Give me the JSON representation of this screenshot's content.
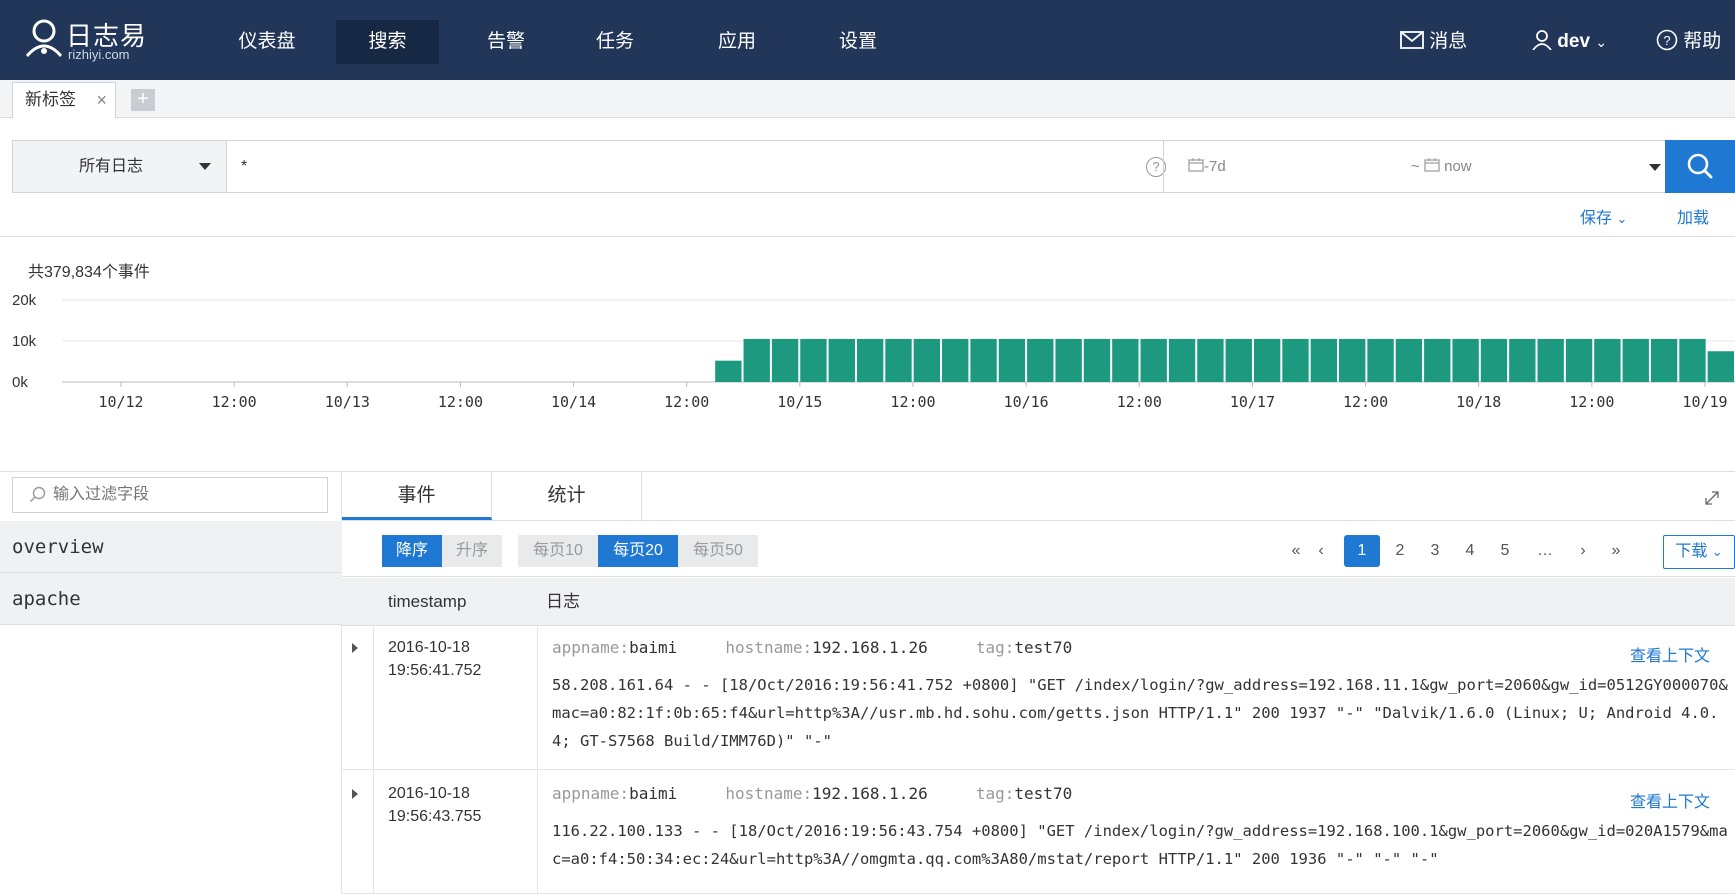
{
  "brand": {
    "name_cn": "日志易",
    "domain": "rizhiyi.com"
  },
  "nav": {
    "items": [
      {
        "label": "仪表盘"
      },
      {
        "label": "搜索"
      },
      {
        "label": "告警"
      },
      {
        "label": "任务"
      },
      {
        "label": "应用"
      },
      {
        "label": "设置"
      }
    ],
    "active": "搜索",
    "messages_label": "消息",
    "user_label": "dev",
    "help_label": "帮助"
  },
  "tabs": {
    "items": [
      {
        "label": "新标签",
        "close": "×"
      }
    ],
    "add_label": "+"
  },
  "search": {
    "source": "所有日志",
    "query": "*",
    "time_from": "-7d",
    "time_sep": "~",
    "time_to": "now",
    "help": "?",
    "save_label": "保存",
    "load_label": "加载"
  },
  "summary": {
    "event_count_text": "共379,834个事件"
  },
  "chart_data": {
    "type": "bar",
    "y_ticks": [
      "20k",
      "10k",
      "0k"
    ],
    "ylim": [
      0,
      20000
    ],
    "x_tick_labels": [
      "10/12",
      "12:00",
      "10/13",
      "12:00",
      "10/14",
      "12:00",
      "10/15",
      "12:00",
      "10/16",
      "12:00",
      "10/17",
      "12:00",
      "10/18",
      "12:00",
      "10/19"
    ],
    "values": [
      0,
      0,
      0,
      0,
      0,
      0,
      0,
      0,
      0,
      0,
      0,
      0,
      0,
      0,
      0,
      0,
      0,
      0,
      0,
      0,
      0,
      0,
      0,
      5200,
      10500,
      10500,
      10500,
      10500,
      10500,
      10500,
      10500,
      10500,
      10500,
      10500,
      10500,
      10500,
      10500,
      10500,
      10500,
      10500,
      10500,
      10500,
      10500,
      10500,
      10500,
      10500,
      10500,
      10500,
      10500,
      10500,
      10500,
      10500,
      10500,
      10500,
      10500,
      10500,
      10500,
      10500,
      7500
    ],
    "color": "#1d9980",
    "grid": true
  },
  "fields": {
    "filter_placeholder": "输入过滤字段",
    "groups": [
      {
        "label": "overview"
      },
      {
        "label": "apache"
      }
    ]
  },
  "results": {
    "tabs": [
      {
        "label": "事件"
      },
      {
        "label": "统计"
      }
    ],
    "sort": {
      "desc": "降序",
      "asc": "升序"
    },
    "page_sizes": [
      {
        "label": "每页10"
      },
      {
        "label": "每页20"
      },
      {
        "label": "每页50"
      }
    ],
    "active_page_size": "每页20",
    "pagination": {
      "first": "«",
      "prev": "‹",
      "pages": [
        "1",
        "2",
        "3",
        "4",
        "5"
      ],
      "current": "1",
      "ellipsis": "…",
      "next": "›",
      "last": "»"
    },
    "download_label": "下载",
    "columns": [
      "timestamp",
      "日志"
    ],
    "context_label": "查看上下文",
    "rows": [
      {
        "date": "2016-10-18",
        "time": "19:56:41.752",
        "appname_key": "appname:",
        "appname": "baimi",
        "hostname_key": "hostname:",
        "hostname": "192.168.1.26",
        "tag_key": "tag:",
        "tag": "test70",
        "log": "58.208.161.64 - - [18/Oct/2016:19:56:41.752 +0800] \"GET /index/login/?gw_address=192.168.11.1&gw_port=2060&gw_id=0512GY000070&mac=a0:82:1f:0b:65:f4&url=http%3A//usr.mb.hd.sohu.com/getts.json HTTP/1.1\" 200 1937 \"-\" \"Dalvik/1.6.0 (Linux; U; Android 4.0.4; GT-S7568 Build/IMM76D)\" \"-\""
      },
      {
        "date": "2016-10-18",
        "time": "19:56:43.755",
        "appname_key": "appname:",
        "appname": "baimi",
        "hostname_key": "hostname:",
        "hostname": "192.168.1.26",
        "tag_key": "tag:",
        "tag": "test70",
        "log": "116.22.100.133 - - [18/Oct/2016:19:56:43.754 +0800] \"GET /index/login/?gw_address=192.168.100.1&gw_port=2060&gw_id=020A1579&mac=a0:f4:50:34:ec:24&url=http%3A//omgmta.qq.com%3A80/mstat/report HTTP/1.1\" 200 1936 \"-\" \"-\" \"-\""
      }
    ]
  },
  "colors": {
    "topbar": "#213658",
    "accent": "#1f78d1",
    "bar": "#1d9980"
  }
}
